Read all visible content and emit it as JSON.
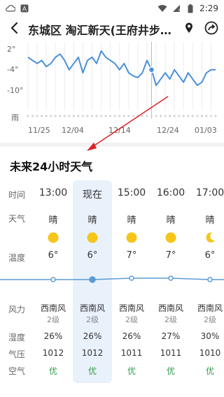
{
  "status_bar": {
    "time": "2:29",
    "icons": [
      "cloud-icon",
      "a-icon",
      "wifi-icon",
      "signal-icon",
      "battery-icon"
    ]
  },
  "header": {
    "title": "东城区 淘汇新天(王府井步行...",
    "back_icon": "back-arrow-icon",
    "location_icon": "location-pin-icon",
    "share_icon": "share-icon"
  },
  "chart_data": {
    "type": "line",
    "ytick_labels": [
      "2°",
      "-4°",
      "-10°"
    ],
    "ytick_values": [
      2,
      -4,
      -10
    ],
    "extra_row_label": "雨",
    "xtick_labels": [
      "11/25",
      "12/04",
      "12/14",
      "12/24",
      "01/03"
    ],
    "xtick_positions": [
      0,
      9,
      19,
      29,
      39
    ],
    "ylim": [
      3,
      -14
    ],
    "current_index": 27,
    "series": [
      {
        "values": [
          -1,
          -2,
          -3,
          -2,
          -4,
          -3,
          -1,
          0,
          -2,
          -5,
          -3,
          -1,
          -6,
          -2,
          -1,
          -3,
          1,
          -1,
          -2,
          -3,
          -5,
          -3,
          -6,
          -7,
          -7.5,
          -6,
          -2,
          -5,
          -10,
          -8,
          -6,
          -8,
          -5,
          -7,
          -9,
          -6,
          -8,
          -10,
          -9,
          -6,
          -5,
          -5
        ]
      }
    ],
    "grid": true,
    "accent_color": "#4a90d9"
  },
  "section_title": "未来24小时天气",
  "row_labels": {
    "time": "时间",
    "weather": "天气",
    "temp": "温度",
    "wind": "风力",
    "humidity": "湿度",
    "pressure": "气压",
    "air": "空气"
  },
  "hours": [
    {
      "time": "13:00",
      "weather": "晴",
      "icon": "sun-icon",
      "temp": "6°",
      "temp_value": 6,
      "wind_dir": "西南风",
      "wind_level": "2级",
      "humidity": "26%",
      "pressure": "1012",
      "air": "优",
      "current": false
    },
    {
      "time": "现在",
      "weather": "晴",
      "icon": "sun-icon",
      "temp": "6°",
      "temp_value": 6,
      "wind_dir": "西南风",
      "wind_level": "2级",
      "humidity": "26%",
      "pressure": "1012",
      "air": "优",
      "current": true
    },
    {
      "time": "15:00",
      "weather": "晴",
      "icon": "sun-icon",
      "temp": "7°",
      "temp_value": 7,
      "wind_dir": "西南风",
      "wind_level": "2级",
      "humidity": "26%",
      "pressure": "1011",
      "air": "优",
      "current": false
    },
    {
      "time": "16:00",
      "weather": "晴",
      "icon": "sun-icon",
      "temp": "7°",
      "temp_value": 7,
      "wind_dir": "西南风",
      "wind_level": "2级",
      "humidity": "27%",
      "pressure": "1011",
      "air": "优",
      "current": false
    },
    {
      "time": "17:00",
      "weather": "晴",
      "icon": "moon-icon",
      "temp": "6°",
      "temp_value": 6,
      "wind_dir": "西南风",
      "wind_level": "2级",
      "humidity": "30%",
      "pressure": "1010",
      "air": "优",
      "current": false
    }
  ],
  "colors": {
    "sun": "#f5c518",
    "temp_line": "#5b9bd5",
    "air_good": "#2d9c4a",
    "annotation_arrow": "#d22"
  }
}
